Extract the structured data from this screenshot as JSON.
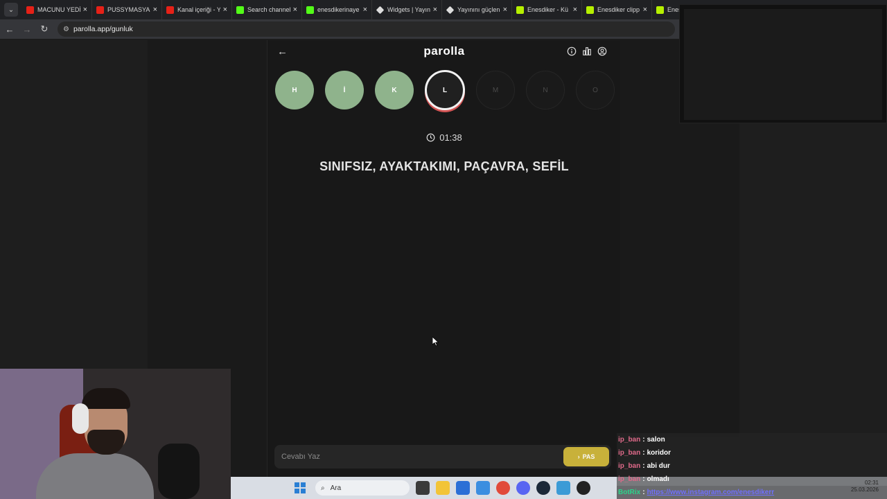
{
  "tabs": [
    {
      "title": "MACUNU YEDİ",
      "icon": "youtube-icon"
    },
    {
      "title": "PUSSYMASYA",
      "icon": "youtube-icon"
    },
    {
      "title": "Kanal içeriği - Y",
      "icon": "youtube-icon"
    },
    {
      "title": "Search channel",
      "icon": "kick-icon"
    },
    {
      "title": "enesdikerinaye",
      "icon": "kick-icon"
    },
    {
      "title": "Widgets | Yayın",
      "icon": "widget-icon"
    },
    {
      "title": "Yayınını güçlen",
      "icon": "widget-icon"
    },
    {
      "title": "Enesdiker - Kü",
      "icon": "clip-icon"
    },
    {
      "title": "Enesdiker clipp",
      "icon": "clip-icon"
    },
    {
      "title": "Enesdi",
      "icon": "clip-icon"
    }
  ],
  "address": {
    "url": "parolla.app/gunluk"
  },
  "app": {
    "logo": "parolla",
    "letters": [
      {
        "char": "H",
        "state": "done"
      },
      {
        "char": "İ",
        "state": "done"
      },
      {
        "char": "K",
        "state": "done"
      },
      {
        "char": "L",
        "state": "active"
      },
      {
        "char": "M",
        "state": "pending"
      },
      {
        "char": "N",
        "state": "pending"
      },
      {
        "char": "O",
        "state": "pending"
      }
    ],
    "timer": "01:38",
    "clue": "SINIFSIZ, AYAKTAKIMI, PAÇAVRA, SEFİL",
    "answer_placeholder": "Cevabı Yaz",
    "pass_label": "PAS"
  },
  "chat": [
    {
      "user": "ip_ban",
      "msg": "salon"
    },
    {
      "user": "ip_ban",
      "msg": "koridor"
    },
    {
      "user": "ip_ban",
      "msg": "abi dur"
    },
    {
      "user": "ip_ban",
      "msg": "olmadı"
    }
  ],
  "botrix": {
    "name": "BotRix",
    "msg": "https://www.instagram.com/enesdikerr"
  },
  "taskbar": {
    "search_label": "Ara",
    "time": "02:31",
    "date": "25.03.2026"
  }
}
